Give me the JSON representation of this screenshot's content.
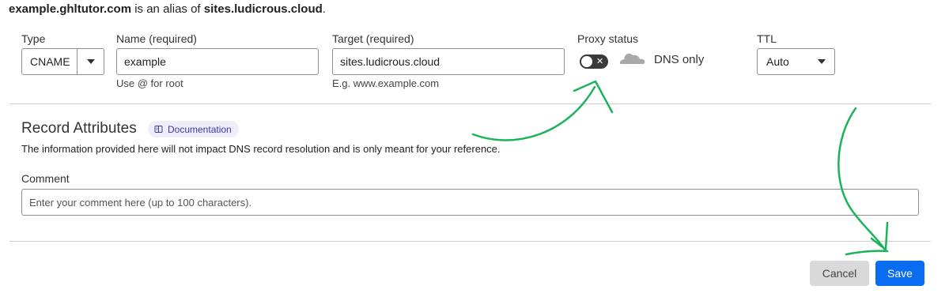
{
  "alias": {
    "domain": "example.ghltutor.com",
    "middle": " is an alias of ",
    "target": "sites.ludicrous.cloud",
    "end": "."
  },
  "fields": {
    "type": {
      "label": "Type",
      "value": "CNAME"
    },
    "name": {
      "label": "Name (required)",
      "value": "example",
      "hint": "Use @ for root"
    },
    "target": {
      "label": "Target (required)",
      "value": "sites.ludicrous.cloud",
      "hint": "E.g. www.example.com"
    },
    "proxy": {
      "label": "Proxy status",
      "state_text": "DNS only",
      "enabled": false
    },
    "ttl": {
      "label": "TTL",
      "value": "Auto"
    }
  },
  "attributes": {
    "title": "Record Attributes",
    "doc_link": "Documentation",
    "info": "The information provided here will not impact DNS record resolution and is only meant for your reference.",
    "comment_label": "Comment",
    "comment_placeholder": "Enter your comment here (up to 100 characters)."
  },
  "actions": {
    "cancel": "Cancel",
    "save": "Save"
  },
  "colors": {
    "primary": "#0a6cf0",
    "annotation_arrow": "#1cb45a",
    "doc_badge_bg": "#efedf9",
    "toggle_off": "#3a3a3a"
  },
  "icons": [
    "chevron-down-icon",
    "cloud-icon",
    "book-icon",
    "close-icon",
    "annotation-arrow"
  ]
}
